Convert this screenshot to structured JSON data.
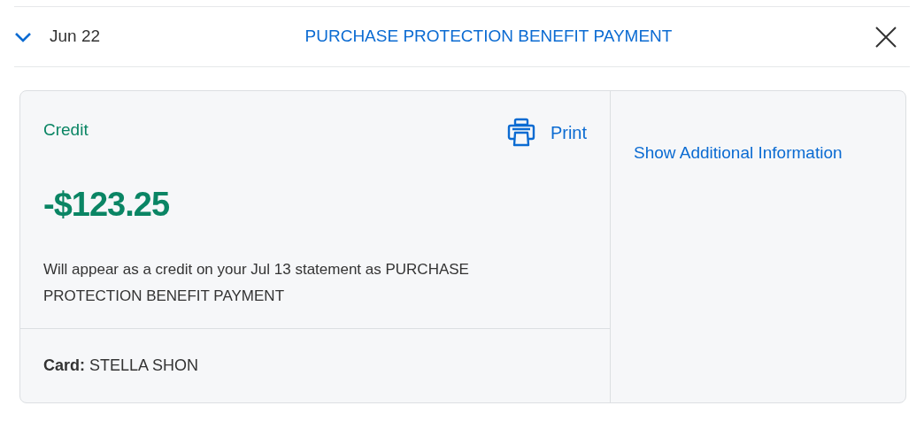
{
  "header": {
    "expanded": true,
    "date": "Jun 22",
    "title": "PURCHASE PROTECTION BENEFIT PAYMENT"
  },
  "detail": {
    "type_label": "Credit",
    "print_label": "Print",
    "amount": "-$123.25",
    "description": "Will appear as a credit on your Jul 13 statement as PURCHASE PROTECTION BENEFIT PAYMENT",
    "card": "**Card:** STELLA SHON",
    "additional_link": "Show Additional Information"
  }
}
